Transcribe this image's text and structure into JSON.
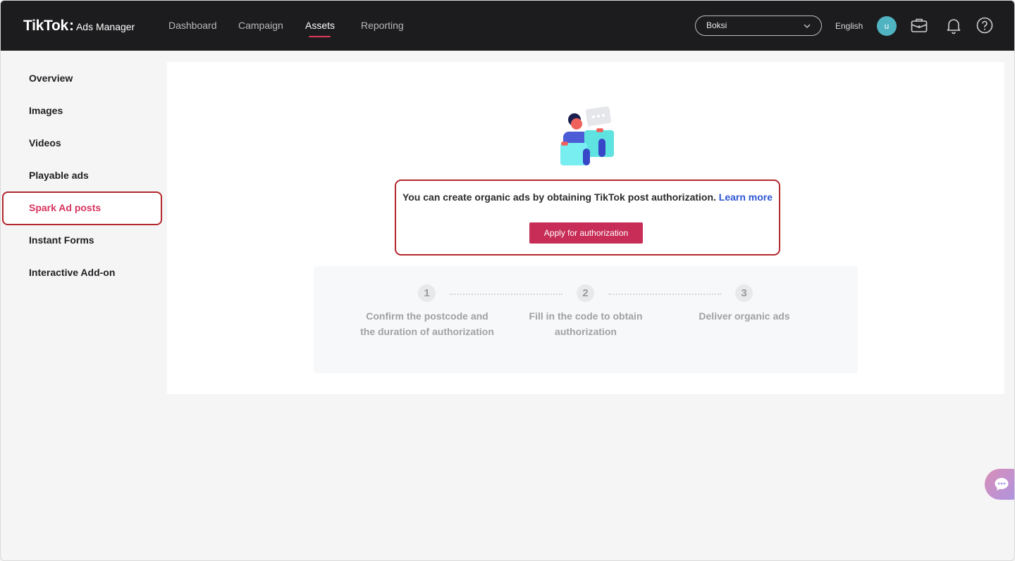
{
  "header": {
    "brand_main": "TikTok",
    "brand_colon": ":",
    "brand_sub": "Ads Manager",
    "nav": [
      {
        "label": "Dashboard"
      },
      {
        "label": "Campaign"
      },
      {
        "label": "Assets"
      },
      {
        "label": "Reporting"
      }
    ],
    "account_select_value": "Boksi",
    "language": "English",
    "avatar_letter": "u",
    "icons": [
      "briefcase-icon",
      "bell-icon",
      "help-icon"
    ],
    "accent_color": "#e0385a"
  },
  "sidebar": {
    "items": [
      {
        "label": "Overview"
      },
      {
        "label": "Images"
      },
      {
        "label": "Videos"
      },
      {
        "label": "Playable ads"
      },
      {
        "label": "Spark Ad posts"
      },
      {
        "label": "Instant Forms"
      },
      {
        "label": "Interactive Add-on"
      }
    ],
    "active_color": "#d8345f"
  },
  "main": {
    "message": "You can create organic ads by obtaining TikTok post authorization.",
    "learn_more": "Learn more",
    "apply_button": "Apply for authorization",
    "steps": [
      {
        "number": "1",
        "text": "Confirm the postcode and the duration of authorization"
      },
      {
        "number": "2",
        "text": "Fill in the code to obtain authorization"
      },
      {
        "number": "3",
        "text": "Deliver organic ads"
      }
    ],
    "button_color": "#c72d57",
    "link_color": "#2f55d4"
  }
}
